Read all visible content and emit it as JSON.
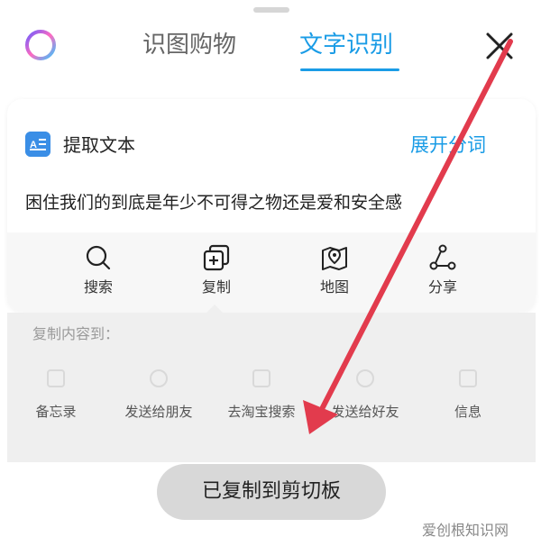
{
  "tabs": [
    {
      "label": "识图购物",
      "active": false
    },
    {
      "label": "文字识别",
      "active": true
    }
  ],
  "card": {
    "title": "提取文本",
    "expand_link": "展开分词",
    "result_text": "困住我们的到底是年少不可得之物还是爱和安全感"
  },
  "actions": [
    {
      "label": "搜索",
      "icon": "search-icon"
    },
    {
      "label": "复制",
      "icon": "copy-icon"
    },
    {
      "label": "地图",
      "icon": "map-icon"
    },
    {
      "label": "分享",
      "icon": "share-icon"
    }
  ],
  "copy_sheet": {
    "title": "复制内容到：",
    "targets": [
      {
        "label": "备忘录",
        "icon": "memo-icon"
      },
      {
        "label": "发送给朋友",
        "icon": "wechat-icon"
      },
      {
        "label": "去淘宝搜索",
        "icon": "taobao-icon"
      },
      {
        "label": "发送给好友",
        "icon": "qq-icon"
      },
      {
        "label": "信息",
        "icon": "message-icon"
      }
    ]
  },
  "toast": "已复制到剪切板",
  "watermark": "爱创根知识网",
  "colors": {
    "accent": "#1a9ce6",
    "annotation_arrow": "#e23b4d"
  }
}
